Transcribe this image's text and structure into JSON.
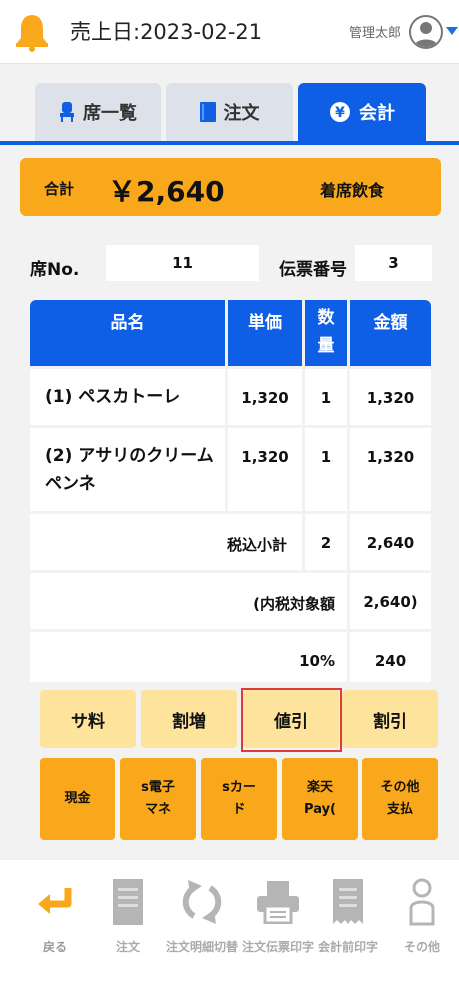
{
  "header": {
    "sales_date": "売上日:2023-02-21",
    "user_name": "管理太郎"
  },
  "tabs": [
    {
      "label": "席一覧",
      "icon": "seat-icon"
    },
    {
      "label": "注文",
      "icon": "book-icon"
    },
    {
      "label": "会計",
      "icon": "yen-icon",
      "active": true
    }
  ],
  "summary": {
    "total_label": "合計",
    "total_amount": "￥2,640",
    "dine_type": "着席飲食"
  },
  "seat": {
    "label": "席No.",
    "value": "11"
  },
  "slip": {
    "label": "伝票番号",
    "value": "3"
  },
  "table": {
    "headers": {
      "name": "品名",
      "unit_price": "単価",
      "qty_line1": "数",
      "qty_line2": "量",
      "amount": "金額"
    },
    "rows": [
      {
        "name": "(1) ペスカトーレ",
        "unit_price": "1,320",
        "qty": "1",
        "amount": "1,320"
      },
      {
        "name": "(2) アサリのクリームペンネ",
        "unit_price": "1,320",
        "qty": "1",
        "amount": "1,320"
      }
    ],
    "subtotal": {
      "label": "税込小計",
      "qty": "2",
      "amount": "2,640"
    },
    "taxable": {
      "label": "(内税対象額",
      "amount": "2,640)"
    },
    "tax": {
      "rate": "10%",
      "amount": "240"
    }
  },
  "adjust_buttons": [
    "サ料",
    "割増",
    "値引",
    "割引"
  ],
  "pay_buttons": [
    {
      "line1": "現金",
      "line2": ""
    },
    {
      "line1": "s電子",
      "line2": "マネ"
    },
    {
      "line1": "sカー",
      "line2": "ド"
    },
    {
      "line1": "楽天",
      "line2": "Pay("
    },
    {
      "line1": "その他",
      "line2": "支払"
    }
  ],
  "footer": [
    {
      "label": "戻る",
      "icon": "return-icon"
    },
    {
      "label": "注文",
      "icon": "order-slip-icon"
    },
    {
      "label": "注文明細切替",
      "icon": "refresh-icon"
    },
    {
      "label": "注文伝票印字",
      "icon": "printer-icon"
    },
    {
      "label": "会計前印字",
      "icon": "receipt-icon"
    },
    {
      "label": "その他",
      "icon": "person-icon"
    }
  ],
  "colors": {
    "accent": "#0f5fe6",
    "total_bg": "#f9a81b",
    "adjust_bg": "#fde39b",
    "highlight": "#e03a3a"
  }
}
